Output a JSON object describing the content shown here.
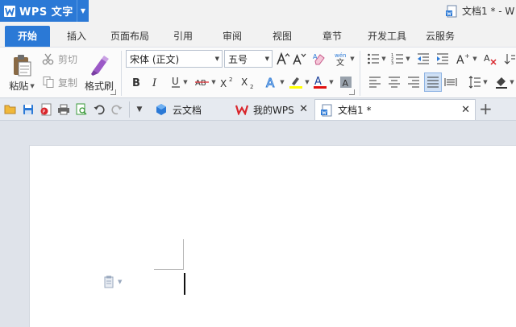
{
  "app": {
    "name": "WPS 文字",
    "document_title": "文档1 * - W"
  },
  "ribbon_tabs": [
    {
      "label": "开始",
      "active": true
    },
    {
      "label": "插入"
    },
    {
      "label": "页面布局"
    },
    {
      "label": "引用"
    },
    {
      "label": "审阅"
    },
    {
      "label": "视图"
    },
    {
      "label": "章节"
    },
    {
      "label": "开发工具"
    },
    {
      "label": "云服务"
    }
  ],
  "clipboard": {
    "paste_label": "粘贴",
    "cut_label": "剪切",
    "copy_label": "复制",
    "format_painter_label": "格式刷"
  },
  "font": {
    "family": "宋体 (正文)",
    "size": "五号"
  },
  "doc_tabs": [
    {
      "label": "云文档"
    },
    {
      "label": "我的WPS"
    },
    {
      "label": "文档1 *",
      "active": true
    }
  ],
  "colors": {
    "accent": "#2b79d6",
    "highlight_bar": "#ffff00",
    "font_color_bar": "#e01010",
    "wps_red": "#d9262c"
  }
}
